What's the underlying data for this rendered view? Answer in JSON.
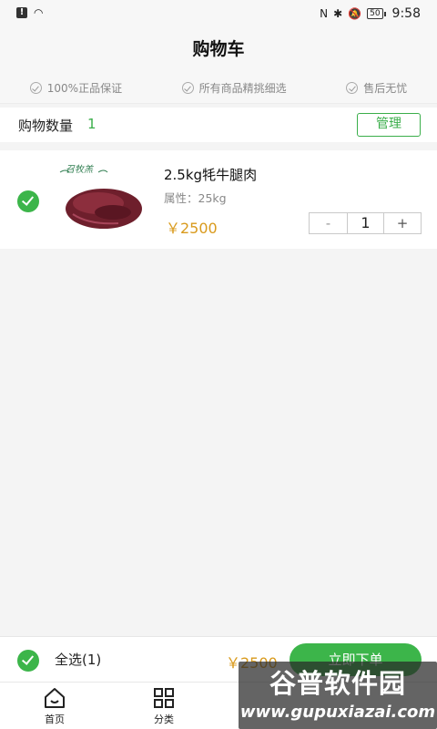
{
  "status_bar": {
    "time": "9:58",
    "battery": "50",
    "nfc_glyph": "N",
    "bluetooth_glyph": "✱",
    "mute_glyph": "🔕",
    "alert_glyph": "!",
    "wifi_glyph": "◠"
  },
  "header": {
    "title": "购物车"
  },
  "guarantees": [
    {
      "label": "100%正品保证"
    },
    {
      "label": "所有商品精挑细选"
    },
    {
      "label": "售后无忧"
    }
  ],
  "cart_summary": {
    "count_label": "购物数量",
    "count_value": "1",
    "manage_label": "管理"
  },
  "items": [
    {
      "name": "2.5kg牦牛腿肉",
      "attribute": "属性：25kg",
      "price": "￥2500",
      "quantity": "1",
      "minus": "-",
      "plus": "+",
      "image_icon": "beef-product-image",
      "image_brand": "召牧羔",
      "checked": true
    }
  ],
  "checkout": {
    "select_all_label": "全选(1)",
    "total": "￥2500",
    "order_button": "立即下单"
  },
  "tabs": [
    {
      "label": "首页",
      "icon": "home-icon"
    },
    {
      "label": "分类",
      "icon": "grid-icon"
    }
  ],
  "watermark": {
    "title": "谷普软件园",
    "url": "www.gupuxiazai.com"
  },
  "colors": {
    "accent_green": "#3cb54a",
    "price_orange": "#d99a1c",
    "background": "#f4f4f4"
  }
}
